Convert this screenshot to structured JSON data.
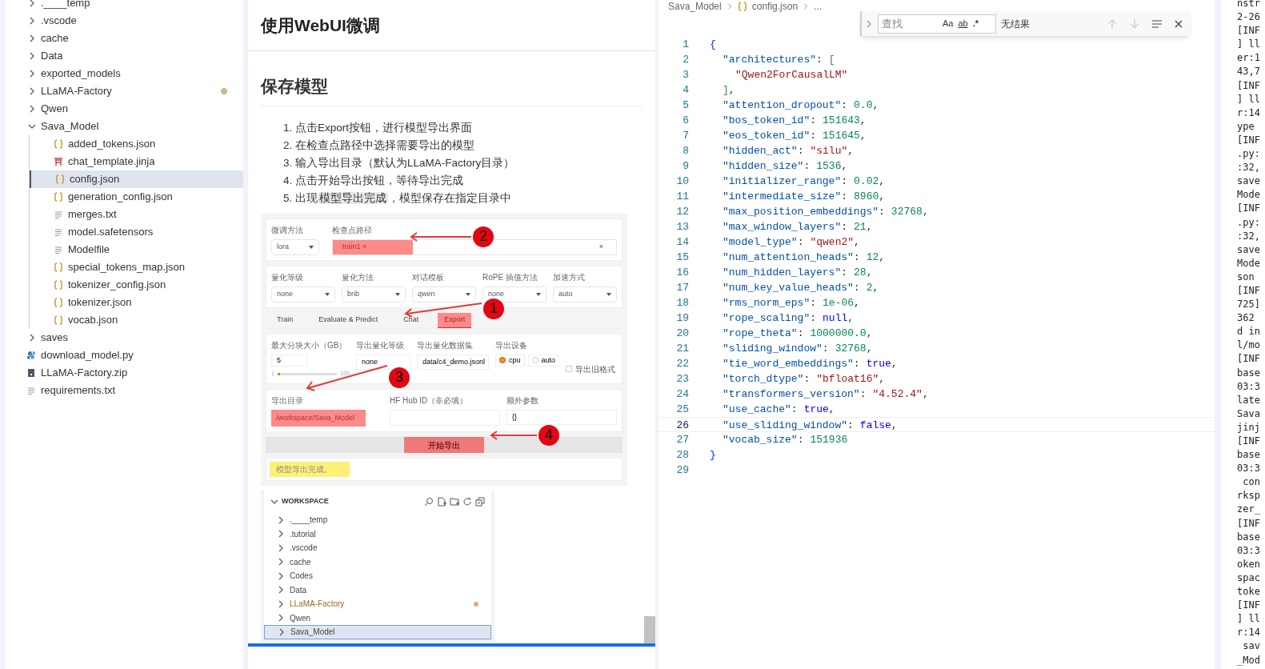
{
  "sidebar": {
    "items": [
      {
        "label": ".____temp",
        "kind": "folder",
        "expanded": false,
        "selected": false,
        "modified": false
      },
      {
        "label": ".vscode",
        "kind": "folder",
        "expanded": false,
        "selected": false,
        "modified": false
      },
      {
        "label": "cache",
        "kind": "folder",
        "expanded": false,
        "selected": false,
        "modified": false
      },
      {
        "label": "Data",
        "kind": "folder",
        "expanded": false,
        "selected": false,
        "modified": false
      },
      {
        "label": "exported_models",
        "kind": "folder",
        "expanded": false,
        "selected": false,
        "modified": false
      },
      {
        "label": "LLaMA-Factory",
        "kind": "folder",
        "expanded": false,
        "selected": false,
        "modified": true
      },
      {
        "label": "Qwen",
        "kind": "folder",
        "expanded": false,
        "selected": false,
        "modified": false
      },
      {
        "label": "Sava_Model",
        "kind": "folder",
        "expanded": true,
        "selected": false,
        "modified": false,
        "children": [
          {
            "label": "added_tokens.json",
            "kind": "json",
            "selected": false,
            "modified": false
          },
          {
            "label": "chat_template.jinja",
            "kind": "jinja",
            "selected": false,
            "modified": false
          },
          {
            "label": "config.json",
            "kind": "json",
            "selected": true,
            "modified": false
          },
          {
            "label": "generation_config.json",
            "kind": "json",
            "selected": false,
            "modified": false
          },
          {
            "label": "merges.txt",
            "kind": "text",
            "selected": false,
            "modified": false
          },
          {
            "label": "model.safetensors",
            "kind": "text",
            "selected": false,
            "modified": false
          },
          {
            "label": "Modelfile",
            "kind": "text",
            "selected": false,
            "modified": false
          },
          {
            "label": "special_tokens_map.json",
            "kind": "json",
            "selected": false,
            "modified": false
          },
          {
            "label": "tokenizer_config.json",
            "kind": "json",
            "selected": false,
            "modified": false
          },
          {
            "label": "tokenizer.json",
            "kind": "json",
            "selected": false,
            "modified": false
          },
          {
            "label": "vocab.json",
            "kind": "json",
            "selected": false,
            "modified": false
          }
        ]
      },
      {
        "label": "saves",
        "kind": "folder",
        "expanded": false,
        "selected": false,
        "modified": false
      },
      {
        "label": "download_model.py",
        "kind": "python",
        "selected": false,
        "modified": false
      },
      {
        "label": "LLaMA-Factory.zip",
        "kind": "zip",
        "selected": false,
        "modified": false
      },
      {
        "label": "requirements.txt",
        "kind": "text",
        "selected": false,
        "modified": false
      }
    ]
  },
  "preview": {
    "sticky_heading": "使用WebUI微调",
    "heading": "保存模型",
    "steps": [
      {
        "number": "1.",
        "text": "点击Export按钮，进行模型导出界面"
      },
      {
        "number": "2.",
        "text": "在检查点路径中选择需要导出的模型"
      },
      {
        "number": "3.",
        "text": "输入导出目录（默认为LLaMA-Factory目录）"
      },
      {
        "number": "4.",
        "text": "点击开始导出按钮，等待导出完成"
      },
      {
        "number": "5.",
        "text": "出现",
        "code": "模型导出完成",
        "after": "，模型保存在指定目录中"
      }
    ],
    "webui_screenshot": {
      "finetune_method": {
        "label": "微调方法",
        "value": "lora"
      },
      "checkpoint": {
        "label": "检查点路径",
        "chip": "train1",
        "chip_close": "×",
        "clear": "×"
      },
      "settings": [
        {
          "label": "量化等级",
          "value": "none"
        },
        {
          "label": "量化方法",
          "value": "bnb"
        },
        {
          "label": "对话模板",
          "value": "qwen"
        },
        {
          "label": "RoPE 插值方法",
          "value": "none"
        },
        {
          "label": "加速方式",
          "value": "auto"
        }
      ],
      "tabs": [
        {
          "label": "Train",
          "selected": false
        },
        {
          "label": "Evaluate & Predict",
          "selected": false
        },
        {
          "label": "Chat",
          "selected": false
        },
        {
          "label": "Export",
          "selected": true
        }
      ],
      "shard": {
        "label": "最大分块大小（GB）",
        "value": "5",
        "min": "1",
        "max": "100",
        "level": 0.04
      },
      "export_quant": {
        "label": "导出量化等级",
        "value": "none"
      },
      "export_dataset": {
        "label": "导出量化数据集",
        "value": "data/c4_demo.jsonl"
      },
      "device": {
        "label": "导出设备",
        "options": [
          {
            "label": "cpu",
            "selected": true
          },
          {
            "label": "auto",
            "selected": false
          }
        ]
      },
      "legacy": {
        "label": "导出旧格式",
        "checked": false
      },
      "export_dir": {
        "label": "导出目录",
        "value": "/workspace/Sava_Model"
      },
      "hub_id": {
        "label": "HF Hub ID（非必填）"
      },
      "extra_args": {
        "label": "额外参数",
        "value": "{}"
      },
      "start_button": "开始导出",
      "output": "模型导出完成。",
      "annotations": [
        "2",
        "1",
        "3",
        "4"
      ]
    },
    "explorer_screenshot": {
      "title": "WORKSPACE",
      "items": [
        {
          "label": ".____temp",
          "selected": false,
          "modified": false
        },
        {
          "label": ".tutorial",
          "selected": false,
          "modified": false
        },
        {
          "label": ".vscode",
          "selected": false,
          "modified": false
        },
        {
          "label": "cache",
          "selected": false,
          "modified": false
        },
        {
          "label": "Codes",
          "selected": false,
          "modified": false
        },
        {
          "label": "Data",
          "selected": false,
          "modified": false
        },
        {
          "label": "LLaMA-Factory",
          "selected": false,
          "modified": true
        },
        {
          "label": "Qwen",
          "selected": false,
          "modified": false
        },
        {
          "label": "Sava_Model",
          "selected": true,
          "modified": false
        }
      ]
    }
  },
  "editor": {
    "breadcrumbs": [
      "Sava_Model",
      "config.json",
      "..."
    ],
    "find": {
      "placeholder": "查找",
      "result": "无结果",
      "match_case": "Aa",
      "whole_word": "ab",
      "regex": ".*"
    },
    "lines": [
      {
        "number": "1",
        "selected": false,
        "tokens": [
          {
            "kind": "brace",
            "text": "{"
          }
        ],
        "children": [
          {
            "number": "2",
            "selected": false,
            "tokens": [
              {
                "kind": "key",
                "text": "\"architectures\""
              },
              {
                "kind": "punct",
                "text": ":"
              },
              {
                "kind": "bracket",
                "text": "["
              }
            ],
            "children": [
              {
                "number": "3",
                "selected": false,
                "tokens": [
                  {
                    "kind": "string",
                    "text": "\"Qwen2ForCausalLM\""
                  }
                ]
              }
            ]
          },
          {
            "number": "4",
            "selected": false,
            "tokens": [
              {
                "kind": "bracket",
                "text": "]"
              },
              {
                "kind": "punct",
                "text": ","
              }
            ]
          },
          {
            "number": "5",
            "selected": false,
            "tokens": [
              {
                "kind": "key",
                "text": "\"attention_dropout\""
              },
              {
                "kind": "punct",
                "text": ":"
              },
              {
                "kind": "number",
                "text": "0.0"
              },
              {
                "kind": "punct",
                "text": ","
              }
            ]
          },
          {
            "number": "6",
            "selected": false,
            "tokens": [
              {
                "kind": "key",
                "text": "\"bos_token_id\""
              },
              {
                "kind": "punct",
                "text": ":"
              },
              {
                "kind": "number",
                "text": "151643"
              },
              {
                "kind": "punct",
                "text": ","
              }
            ]
          },
          {
            "number": "7",
            "selected": false,
            "tokens": [
              {
                "kind": "key",
                "text": "\"eos_token_id\""
              },
              {
                "kind": "punct",
                "text": ":"
              },
              {
                "kind": "number",
                "text": "151645"
              },
              {
                "kind": "punct",
                "text": ","
              }
            ]
          },
          {
            "number": "8",
            "selected": false,
            "tokens": [
              {
                "kind": "key",
                "text": "\"hidden_act\""
              },
              {
                "kind": "punct",
                "text": ":"
              },
              {
                "kind": "string",
                "text": "\"silu\""
              },
              {
                "kind": "punct",
                "text": ","
              }
            ]
          },
          {
            "number": "9",
            "selected": false,
            "tokens": [
              {
                "kind": "key",
                "text": "\"hidden_size\""
              },
              {
                "kind": "punct",
                "text": ":"
              },
              {
                "kind": "number",
                "text": "1536"
              },
              {
                "kind": "punct",
                "text": ","
              }
            ]
          },
          {
            "number": "10",
            "selected": false,
            "tokens": [
              {
                "kind": "key",
                "text": "\"initializer_range\""
              },
              {
                "kind": "punct",
                "text": ":"
              },
              {
                "kind": "number",
                "text": "0.02"
              },
              {
                "kind": "punct",
                "text": ","
              }
            ]
          },
          {
            "number": "11",
            "selected": false,
            "tokens": [
              {
                "kind": "key",
                "text": "\"intermediate_size\""
              },
              {
                "kind": "punct",
                "text": ":"
              },
              {
                "kind": "number",
                "text": "8960"
              },
              {
                "kind": "punct",
                "text": ","
              }
            ]
          },
          {
            "number": "12",
            "selected": false,
            "tokens": [
              {
                "kind": "key",
                "text": "\"max_position_embeddings\""
              },
              {
                "kind": "punct",
                "text": ":"
              },
              {
                "kind": "number",
                "text": "32768"
              },
              {
                "kind": "punct",
                "text": ","
              }
            ]
          },
          {
            "number": "13",
            "selected": false,
            "tokens": [
              {
                "kind": "key",
                "text": "\"max_window_layers\""
              },
              {
                "kind": "punct",
                "text": ":"
              },
              {
                "kind": "number",
                "text": "21"
              },
              {
                "kind": "punct",
                "text": ","
              }
            ]
          },
          {
            "number": "14",
            "selected": false,
            "tokens": [
              {
                "kind": "key",
                "text": "\"model_type\""
              },
              {
                "kind": "punct",
                "text": ":"
              },
              {
                "kind": "string",
                "text": "\"qwen2\""
              },
              {
                "kind": "punct",
                "text": ","
              }
            ]
          },
          {
            "number": "15",
            "selected": false,
            "tokens": [
              {
                "kind": "key",
                "text": "\"num_attention_heads\""
              },
              {
                "kind": "punct",
                "text": ":"
              },
              {
                "kind": "number",
                "text": "12"
              },
              {
                "kind": "punct",
                "text": ","
              }
            ]
          },
          {
            "number": "16",
            "selected": false,
            "tokens": [
              {
                "kind": "key",
                "text": "\"num_hidden_layers\""
              },
              {
                "kind": "punct",
                "text": ":"
              },
              {
                "kind": "number",
                "text": "28"
              },
              {
                "kind": "punct",
                "text": ","
              }
            ]
          },
          {
            "number": "17",
            "selected": false,
            "tokens": [
              {
                "kind": "key",
                "text": "\"num_key_value_heads\""
              },
              {
                "kind": "punct",
                "text": ":"
              },
              {
                "kind": "number",
                "text": "2"
              },
              {
                "kind": "punct",
                "text": ","
              }
            ]
          },
          {
            "number": "18",
            "selected": false,
            "tokens": [
              {
                "kind": "key",
                "text": "\"rms_norm_eps\""
              },
              {
                "kind": "punct",
                "text": ":"
              },
              {
                "kind": "number",
                "text": "1e-06"
              },
              {
                "kind": "punct",
                "text": ","
              }
            ]
          },
          {
            "number": "19",
            "selected": false,
            "tokens": [
              {
                "kind": "key",
                "text": "\"rope_scaling\""
              },
              {
                "kind": "punct",
                "text": ":"
              },
              {
                "kind": "keyword",
                "text": "null"
              },
              {
                "kind": "punct",
                "text": ","
              }
            ]
          },
          {
            "number": "20",
            "selected": false,
            "tokens": [
              {
                "kind": "key",
                "text": "\"rope_theta\""
              },
              {
                "kind": "punct",
                "text": ":"
              },
              {
                "kind": "number",
                "text": "1000000.0"
              },
              {
                "kind": "punct",
                "text": ","
              }
            ]
          },
          {
            "number": "21",
            "selected": false,
            "tokens": [
              {
                "kind": "key",
                "text": "\"sliding_window\""
              },
              {
                "kind": "punct",
                "text": ":"
              },
              {
                "kind": "number",
                "text": "32768"
              },
              {
                "kind": "punct",
                "text": ","
              }
            ]
          },
          {
            "number": "22",
            "selected": false,
            "tokens": [
              {
                "kind": "key",
                "text": "\"tie_word_embeddings\""
              },
              {
                "kind": "punct",
                "text": ":"
              },
              {
                "kind": "keyword",
                "text": "true"
              },
              {
                "kind": "punct",
                "text": ","
              }
            ]
          },
          {
            "number": "23",
            "selected": false,
            "tokens": [
              {
                "kind": "key",
                "text": "\"torch_dtype\""
              },
              {
                "kind": "punct",
                "text": ":"
              },
              {
                "kind": "string",
                "text": "\"bfloat16\""
              },
              {
                "kind": "punct",
                "text": ","
              }
            ]
          },
          {
            "number": "24",
            "selected": false,
            "tokens": [
              {
                "kind": "key",
                "text": "\"transformers_version\""
              },
              {
                "kind": "punct",
                "text": ":"
              },
              {
                "kind": "string",
                "text": "\"4.52.4\""
              },
              {
                "kind": "punct",
                "text": ","
              }
            ]
          },
          {
            "number": "25",
            "selected": false,
            "tokens": [
              {
                "kind": "key",
                "text": "\"use_cache\""
              },
              {
                "kind": "punct",
                "text": ":"
              },
              {
                "kind": "keyword",
                "text": "true"
              },
              {
                "kind": "punct",
                "text": ","
              }
            ]
          },
          {
            "number": "26",
            "selected": true,
            "tokens": [
              {
                "kind": "key",
                "text": "\"use_sliding_window\""
              },
              {
                "kind": "punct",
                "text": ":"
              },
              {
                "kind": "keyword",
                "text": "false"
              },
              {
                "kind": "punct",
                "text": ","
              }
            ]
          },
          {
            "number": "27",
            "selected": false,
            "tokens": [
              {
                "kind": "key",
                "text": "\"vocab_size\""
              },
              {
                "kind": "punct",
                "text": ":"
              },
              {
                "kind": "number",
                "text": "151936"
              }
            ]
          }
        ]
      },
      {
        "number": "28",
        "selected": false,
        "tokens": [
          {
            "kind": "brace",
            "text": "}"
          }
        ]
      },
      {
        "number": "29",
        "selected": false
      }
    ]
  },
  "terminal": {
    "lines": [
      "nstr",
      "2-26",
      "[INF",
      "] ll",
      "er:1",
      "43,7",
      "[INF",
      "] ll",
      "r:14",
      "ype",
      "[INF",
      ".py:",
      ":32,",
      "save",
      "Mode",
      "[INF",
      ".py:",
      ":32,",
      "save",
      "Mode",
      "son",
      "[INF",
      "725]",
      "362",
      "d in",
      "l/mo",
      "[INF",
      "base",
      "03:3",
      "late",
      "Sava",
      "jinj",
      "[INF",
      "base",
      "03:3",
      " con",
      "rksp",
      "zer_",
      "[INF",
      "base",
      "03:3",
      "oken",
      "spac",
      "toke",
      "[INF",
      "] ll",
      "r:14",
      " sav",
      "_Mod"
    ]
  }
}
